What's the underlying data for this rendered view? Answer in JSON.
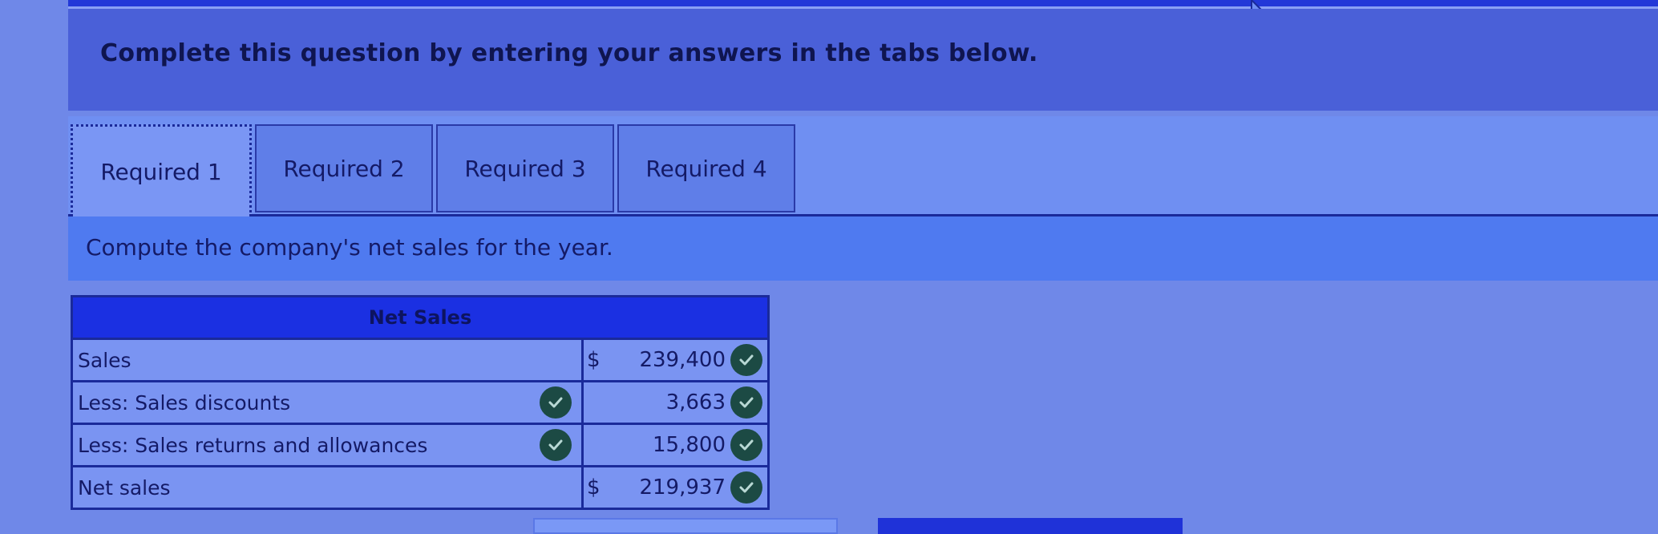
{
  "instruction": {
    "text": "Complete this question by entering your answers in the tabs below."
  },
  "tabs": [
    {
      "label": "Required 1",
      "active": true
    },
    {
      "label": "Required 2",
      "active": false
    },
    {
      "label": "Required 3",
      "active": false
    },
    {
      "label": "Required 4",
      "active": false
    }
  ],
  "prompt": {
    "text": "Compute the company's net sales for the year."
  },
  "table": {
    "title": "Net Sales",
    "rows": [
      {
        "label": "Sales",
        "label_check": false,
        "currency": "$",
        "value": "239,400",
        "value_check": true
      },
      {
        "label": "Less: Sales discounts",
        "label_check": true,
        "currency": "",
        "value": "3,663",
        "value_check": true
      },
      {
        "label": "Less: Sales returns and allowances",
        "label_check": true,
        "currency": "",
        "value": "15,800",
        "value_check": true
      },
      {
        "label": "Net sales",
        "label_check": false,
        "currency": "$",
        "value": "219,937",
        "value_check": true
      }
    ]
  },
  "icons": {
    "check": "check-circle-icon",
    "cursor": "mouse-cursor-icon"
  },
  "colors": {
    "header_blue": "#1b30e2",
    "check_green": "#1c4a44",
    "text_navy": "#141a66"
  }
}
